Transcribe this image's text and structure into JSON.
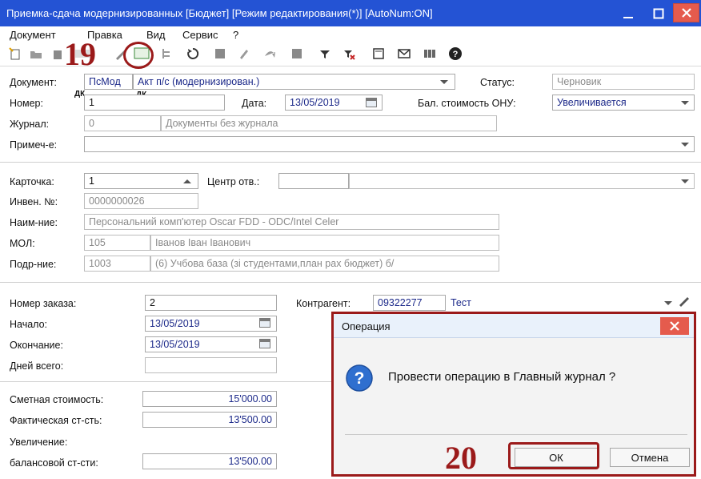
{
  "window": {
    "title": "Приемка-сдача модернизированных [Бюджет] [Режим редактирования(*)] [AutoNum:ON]"
  },
  "menu": [
    "Документ",
    "Правка",
    "Вид",
    "Сервис",
    "?"
  ],
  "toolbar": {
    "dk_label": "ДК",
    "dk_label2": "ДК"
  },
  "form": {
    "document_label": "Документ:",
    "document_code": "ПсМод",
    "document_name": "Акт п/с (модернизирован.)",
    "status_label": "Статус:",
    "status_value": "Черновик",
    "number_label": "Номер:",
    "number_value": "1",
    "date_label": "Дата:",
    "date_value": "13/05/2019",
    "balance_label": "Бал. стоимость ОНУ:",
    "balance_value": "Увеличивается",
    "journal_label": "Журнал:",
    "journal_code": "0",
    "journal_name": "Документы без журнала",
    "note_label": "Примеч-е:",
    "note_value": "",
    "card_label": "Карточка:",
    "card_value": "1",
    "center_label": "Центр отв.:",
    "center_value": "",
    "inv_label": "Инвен. №:",
    "inv_value": "0000000026",
    "name_label": "Наим-ние:",
    "name_value": "Персональний комп'ютер Oscar FDD - ODC/Intel Celer",
    "mol_label": "МОЛ:",
    "mol_code": "105",
    "mol_name": "Іванов Іван Іванович",
    "dept_label": "Подр-ние:",
    "dept_code": "1003",
    "dept_name": "(6) Учбова база (зі студентами,план рах бюджет) б/",
    "order_label": "Номер заказа:",
    "order_value": "2",
    "contractor_label": "Контрагент:",
    "contractor_code": "09322277",
    "contractor_name": "Тест",
    "start_label": "Начало:",
    "start_value": "13/05/2019",
    "end_label": "Окончание:",
    "end_value": "13/05/2019",
    "days_label": "Дней всего:",
    "days_value": "",
    "est_label": "Сметная стоимость:",
    "est_value": "15'000.00",
    "fact_label": "Фактическая ст-сть:",
    "fact_value": "13'500.00",
    "increase_label": "Увеличение:",
    "balance_cost_label": "балансовой ст-сти:",
    "balance_cost_value": "13'500.00"
  },
  "dialog": {
    "title": "Операция",
    "message": "Провести операцию в Главный журнал ?",
    "ok_label": "ОК",
    "cancel_label": "Отмена"
  },
  "annotations": {
    "step1": "19",
    "step2": "20"
  },
  "colors": {
    "titlebar": "#2453d4",
    "annotation": "#9b1a1a",
    "close_button": "#e55b4d"
  }
}
